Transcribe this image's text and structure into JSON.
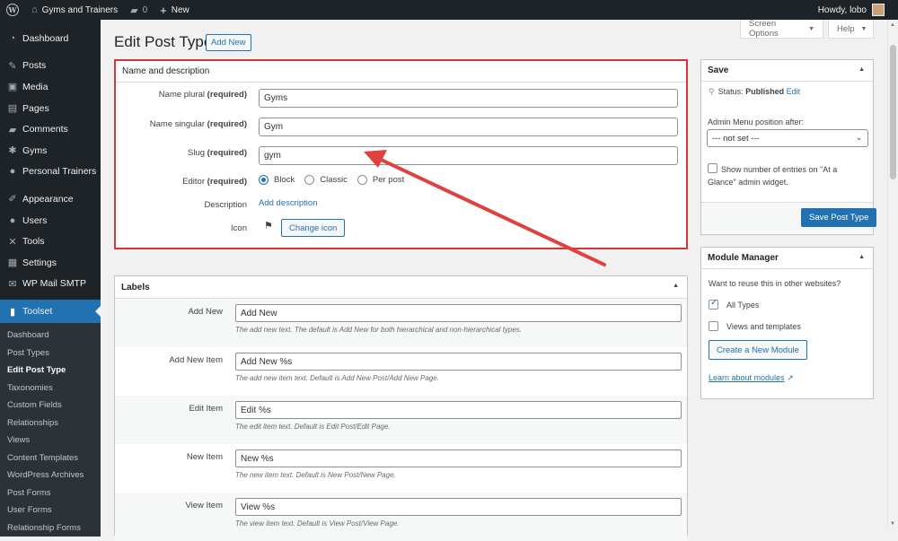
{
  "adminbar": {
    "site_name": "Gyms and Trainers",
    "comments_count": "0",
    "new_label": "New",
    "howdy": "Howdy, lobo"
  },
  "sidebar": {
    "items": [
      {
        "label": "Dashboard",
        "icon": "dashboard-icon"
      },
      {
        "label": "Posts",
        "icon": "pin-icon"
      },
      {
        "label": "Media",
        "icon": "media-icon"
      },
      {
        "label": "Pages",
        "icon": "page-icon"
      },
      {
        "label": "Comments",
        "icon": "comment-icon"
      },
      {
        "label": "Gyms",
        "icon": "gear-icon"
      },
      {
        "label": "Personal Trainers",
        "icon": "person-icon"
      },
      {
        "label": "Appearance",
        "icon": "brush-icon"
      },
      {
        "label": "Users",
        "icon": "users-icon"
      },
      {
        "label": "Tools",
        "icon": "wrench-icon"
      },
      {
        "label": "Settings",
        "icon": "settings-icon"
      },
      {
        "label": "WP Mail SMTP",
        "icon": "mail-icon"
      }
    ],
    "current": {
      "label": "Toolset",
      "icon": "toolset-icon"
    },
    "submenu": [
      "Dashboard",
      "Post Types",
      "Edit Post Type",
      "Taxonomies",
      "Custom Fields",
      "Relationships",
      "Views",
      "Content Templates",
      "WordPress Archives",
      "Post Forms",
      "User Forms",
      "Relationship Forms"
    ]
  },
  "screen_options": "Screen Options",
  "help": "Help",
  "page": {
    "title": "Edit Post Type",
    "add_new": "Add New"
  },
  "name_box": {
    "title": "Name and description",
    "plural_label": "Name plural",
    "singular_label": "Name singular",
    "slug_label": "Slug",
    "editor_label": "Editor",
    "required": "(required)",
    "plural_value": "Gyms",
    "singular_value": "Gym",
    "slug_value": "gym",
    "editor_options": [
      "Block",
      "Classic",
      "Per post"
    ],
    "editor_selected": "Block",
    "description_label": "Description",
    "description_link": "Add description",
    "icon_label": "Icon",
    "change_icon": "Change icon"
  },
  "labels_box": {
    "title": "Labels",
    "rows": [
      {
        "name": "Add New",
        "value": "Add New",
        "desc": "The add new text. The default is Add New for both hierarchical and non-hierarchical types."
      },
      {
        "name": "Add New Item",
        "value": "Add New %s",
        "desc": "The add new item text. Default is Add New Post/Add New Page."
      },
      {
        "name": "Edit Item",
        "value": "Edit %s",
        "desc": "The edit item text. Default is Edit Post/Edit Page."
      },
      {
        "name": "New Item",
        "value": "New %s",
        "desc": "The new item text. Default is New Post/New Page."
      },
      {
        "name": "View Item",
        "value": "View %s",
        "desc": "The view item text. Default is View Post/View Page."
      }
    ]
  },
  "save_box": {
    "title": "Save",
    "status_label": "Status:",
    "status_value": "Published",
    "edit_link": "Edit",
    "menu_position_label": "Admin Menu position after:",
    "menu_position_value": "--- not set ---",
    "glance_line1": "Show number of entries on \"At a",
    "glance_line2": "Glance\" admin widget.",
    "save_button": "Save Post Type"
  },
  "module_box": {
    "title": "Module Manager",
    "question": "Want to reuse this in other websites?",
    "all_types": "All Types",
    "views_templates": "Views and templates",
    "create_button": "Create a New Module",
    "learn_link": "Learn about modules"
  },
  "colors": {
    "accent": "#2271b1",
    "highlight_border": "#d63638",
    "arrow": "#e0413e",
    "adminbar": "#1d2327"
  }
}
